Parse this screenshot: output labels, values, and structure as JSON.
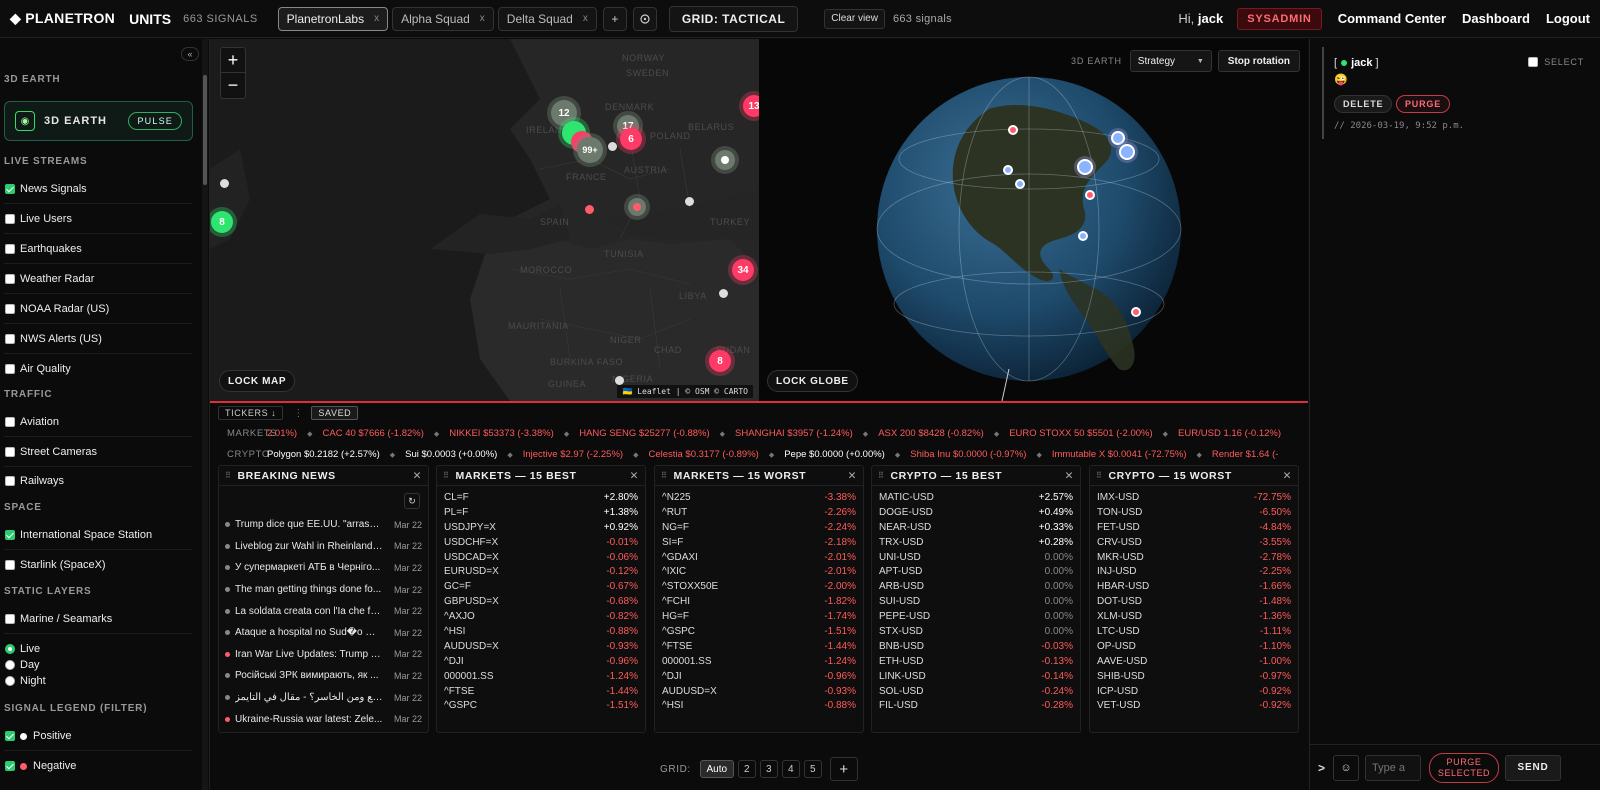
{
  "topbar": {
    "brand": "◆ PLANETRON",
    "units": "UNITS",
    "signal_count": "663 SIGNALS",
    "tabs": [
      {
        "label": "PlanetronLabs",
        "close": "x"
      },
      {
        "label": "Alpha Squad",
        "close": "x"
      },
      {
        "label": "Delta Squad",
        "close": "x"
      }
    ],
    "add_tab": "+",
    "grid_label": "GRID: TACTICAL",
    "clear_view": "Clear view",
    "signals": "663 signals",
    "greeting": "Hi,",
    "username": "jack",
    "role_badge": "SYSADMIN",
    "nav": [
      "Command Center",
      "Dashboard",
      "Logout"
    ]
  },
  "sidebar": {
    "collapse": "«",
    "sec_3d": "3D EARTH",
    "earth_label": "3D EARTH",
    "pulse": "PULSE",
    "sec_live": "LIVE STREAMS",
    "live": [
      {
        "label": "News Signals",
        "checked": true
      },
      {
        "label": "Live Users",
        "checked": false
      },
      {
        "label": "Earthquakes",
        "checked": false
      },
      {
        "label": "Weather Radar",
        "checked": false
      },
      {
        "label": "NOAA Radar (US)",
        "checked": false
      },
      {
        "label": "NWS Alerts (US)",
        "checked": false
      },
      {
        "label": "Air Quality",
        "checked": false
      }
    ],
    "sec_traffic": "TRAFFIC",
    "traffic": [
      {
        "label": "Aviation",
        "checked": false
      },
      {
        "label": "Street Cameras",
        "checked": false
      },
      {
        "label": "Railways",
        "checked": false
      }
    ],
    "sec_space": "SPACE",
    "space": [
      {
        "label": "International Space Station",
        "checked": true
      },
      {
        "label": "Starlink (SpaceX)",
        "checked": false
      }
    ],
    "sec_static": "STATIC LAYERS",
    "static": [
      {
        "label": "Marine / Seamarks",
        "checked": false
      }
    ],
    "radios": [
      {
        "label": "Live",
        "checked": true
      },
      {
        "label": "Day",
        "checked": false
      },
      {
        "label": "Night",
        "checked": false
      }
    ],
    "sec_legend": "SIGNAL LEGEND (FILTER)",
    "legend": [
      {
        "label": "Positive",
        "color": "#ffffff"
      },
      {
        "label": "Negative",
        "color": "#ff5b6b"
      }
    ]
  },
  "map": {
    "zoom_in": "+",
    "zoom_out": "−",
    "lock": "LOCK MAP",
    "attribution": "🇺🇦 Leaflet | © OSM © CARTO",
    "countries": [
      "NORWAY",
      "SWEDEN",
      "DENMARK",
      "IRELAND",
      "POLAND",
      "BELARUS",
      "FRANCE",
      "AUSTRIA",
      "SPAIN",
      "TURKEY",
      "TUNISIA",
      "MOROCCO",
      "LIBYA",
      "MAURITANIA",
      "NIGER",
      "CHAD",
      "BURKINA FASO",
      "GUINEA",
      "SUDAN",
      "NIGERIA"
    ],
    "clusters": [
      "12",
      "17",
      "6",
      "99+",
      "13",
      "8",
      "34",
      "8"
    ]
  },
  "globe": {
    "label": "3D EARTH",
    "mode": "Strategy",
    "stop": "Stop rotation",
    "lock": "LOCK GLOBE"
  },
  "tickers": {
    "tickers_btn": "TICKERS ↓",
    "more": "⋮",
    "saved": "SAVED",
    "markets_label": "MARKETS",
    "markets": [
      {
        "t": "2.01%)",
        "neg": true
      },
      {
        "t": "CAC 40 $7666 (-1.82%)",
        "neg": true
      },
      {
        "t": "NIKKEI $53373 (-3.38%)",
        "neg": true
      },
      {
        "t": "HANG SENG $25277 (-0.88%)",
        "neg": true
      },
      {
        "t": "SHANGHAI $3957 (-1.24%)",
        "neg": true
      },
      {
        "t": "ASX 200 $8428 (-0.82%)",
        "neg": true
      },
      {
        "t": "EURO STOXX 50 $5501 (-2.00%)",
        "neg": true
      },
      {
        "t": "EUR/USD 1.16 (-0.12%)",
        "neg": true
      }
    ],
    "crypto_label": "CRYPTO",
    "crypto": [
      {
        "t": "Polygon $0.2182 (+2.57%)",
        "neg": false
      },
      {
        "t": "Sui $0.0003 (+0.00%)",
        "neg": false
      },
      {
        "t": "Injective $2.97 (-2.25%)",
        "neg": true
      },
      {
        "t": "Celestia $0.3177 (-0.89%)",
        "neg": true
      },
      {
        "t": "Pepe $0.0000 (+0.00%)",
        "neg": false
      },
      {
        "t": "Shiba Inu $0.0000 (-0.97%)",
        "neg": true
      },
      {
        "t": "Immutable X $0.0041 (-72.75%)",
        "neg": true
      },
      {
        "t": "Render $1.64 (-",
        "neg": true
      }
    ]
  },
  "panels": {
    "news": {
      "title": "BREAKING NEWS",
      "refresh": "↻",
      "items": [
        {
          "t": "Trump dice que EE.UU. \"arrasar...",
          "d": "Mar 22",
          "c": "#888"
        },
        {
          "t": "Liveblog zur Wahl in Rheinland-...",
          "d": "Mar 22",
          "c": "#888"
        },
        {
          "t": "У супермаркеті АТБ в Черніго...",
          "d": "Mar 22",
          "c": "#888"
        },
        {
          "t": "The man getting things done fo...",
          "d": "Mar 22",
          "c": "#888"
        },
        {
          "t": "La soldata creata con l'Ia che fa...",
          "d": "Mar 22",
          "c": "#888"
        },
        {
          "t": "Ataque a hospital no Sud�o ma...",
          "d": "Mar 22",
          "c": "#888"
        },
        {
          "t": "Iran War Live Updates: Trump T...",
          "d": "Mar 22",
          "c": "#ff5b6b"
        },
        {
          "t": "Російські ЗРК вимирають, як ...",
          "d": "Mar 22",
          "c": "#888"
        },
        {
          "t": "الرابع ومن الخاسر؟ - مقال في التايمز ...",
          "d": "Mar 22",
          "c": "#888"
        },
        {
          "t": "Ukraine-Russia war latest: Zele...",
          "d": "Mar 22",
          "c": "#ff5b6b"
        }
      ]
    },
    "mbest": {
      "title": "MARKETS — 15 BEST",
      "rows": [
        [
          "CL=F",
          "+2.80%"
        ],
        [
          "PL=F",
          "+1.38%"
        ],
        [
          "USDJPY=X",
          "+0.92%"
        ],
        [
          "USDCHF=X",
          "-0.01%"
        ],
        [
          "USDCAD=X",
          "-0.06%"
        ],
        [
          "EURUSD=X",
          "-0.12%"
        ],
        [
          "GC=F",
          "-0.67%"
        ],
        [
          "GBPUSD=X",
          "-0.68%"
        ],
        [
          "^AXJO",
          "-0.82%"
        ],
        [
          "^HSI",
          "-0.88%"
        ],
        [
          "AUDUSD=X",
          "-0.93%"
        ],
        [
          "^DJI",
          "-0.96%"
        ],
        [
          "000001.SS",
          "-1.24%"
        ],
        [
          "^FTSE",
          "-1.44%"
        ],
        [
          "^GSPC",
          "-1.51%"
        ]
      ]
    },
    "mworst": {
      "title": "MARKETS — 15 WORST",
      "rows": [
        [
          "^N225",
          "-3.38%"
        ],
        [
          "^RUT",
          "-2.26%"
        ],
        [
          "NG=F",
          "-2.24%"
        ],
        [
          "SI=F",
          "-2.18%"
        ],
        [
          "^GDAXI",
          "-2.01%"
        ],
        [
          "^IXIC",
          "-2.01%"
        ],
        [
          "^STOXX50E",
          "-2.00%"
        ],
        [
          "^FCHI",
          "-1.82%"
        ],
        [
          "HG=F",
          "-1.74%"
        ],
        [
          "^GSPC",
          "-1.51%"
        ],
        [
          "^FTSE",
          "-1.44%"
        ],
        [
          "000001.SS",
          "-1.24%"
        ],
        [
          "^DJI",
          "-0.96%"
        ],
        [
          "AUDUSD=X",
          "-0.93%"
        ],
        [
          "^HSI",
          "-0.88%"
        ]
      ]
    },
    "cbest": {
      "title": "CRYPTO — 15 BEST",
      "rows": [
        [
          "MATIC-USD",
          "+2.57%"
        ],
        [
          "DOGE-USD",
          "+0.49%"
        ],
        [
          "NEAR-USD",
          "+0.33%"
        ],
        [
          "TRX-USD",
          "+0.28%"
        ],
        [
          "UNI-USD",
          "0.00%"
        ],
        [
          "APT-USD",
          "0.00%"
        ],
        [
          "ARB-USD",
          "0.00%"
        ],
        [
          "SUI-USD",
          "0.00%"
        ],
        [
          "PEPE-USD",
          "0.00%"
        ],
        [
          "STX-USD",
          "0.00%"
        ],
        [
          "BNB-USD",
          "-0.03%"
        ],
        [
          "ETH-USD",
          "-0.13%"
        ],
        [
          "LINK-USD",
          "-0.14%"
        ],
        [
          "SOL-USD",
          "-0.24%"
        ],
        [
          "FIL-USD",
          "-0.28%"
        ]
      ]
    },
    "cworst": {
      "title": "CRYPTO — 15 WORST",
      "rows": [
        [
          "IMX-USD",
          "-72.75%"
        ],
        [
          "TON-USD",
          "-6.50%"
        ],
        [
          "FET-USD",
          "-4.84%"
        ],
        [
          "CRV-USD",
          "-3.55%"
        ],
        [
          "MKR-USD",
          "-2.78%"
        ],
        [
          "INJ-USD",
          "-2.25%"
        ],
        [
          "HBAR-USD",
          "-1.66%"
        ],
        [
          "DOT-USD",
          "-1.48%"
        ],
        [
          "XLM-USD",
          "-1.36%"
        ],
        [
          "LTC-USD",
          "-1.11%"
        ],
        [
          "OP-USD",
          "-1.10%"
        ],
        [
          "AAVE-USD",
          "-1.00%"
        ],
        [
          "SHIB-USD",
          "-0.97%"
        ],
        [
          "ICP-USD",
          "-0.92%"
        ],
        [
          "VET-USD",
          "-0.92%"
        ]
      ]
    }
  },
  "grid": {
    "label": "GRID:",
    "options": [
      "Auto",
      "2",
      "3",
      "4",
      "5"
    ],
    "add": "+"
  },
  "right": {
    "user_prefix": "[",
    "user": "jack",
    "user_suffix": "]",
    "emoji": "😜",
    "select": "SELECT",
    "delete": "DELETE",
    "purge": "PURGE",
    "timestamp": "// 2026-03-19, 9:52 p.m.",
    "prompt": ">",
    "placeholder": "Type a",
    "purge_selected": "PURGE SELECTED",
    "send": "SEND"
  }
}
